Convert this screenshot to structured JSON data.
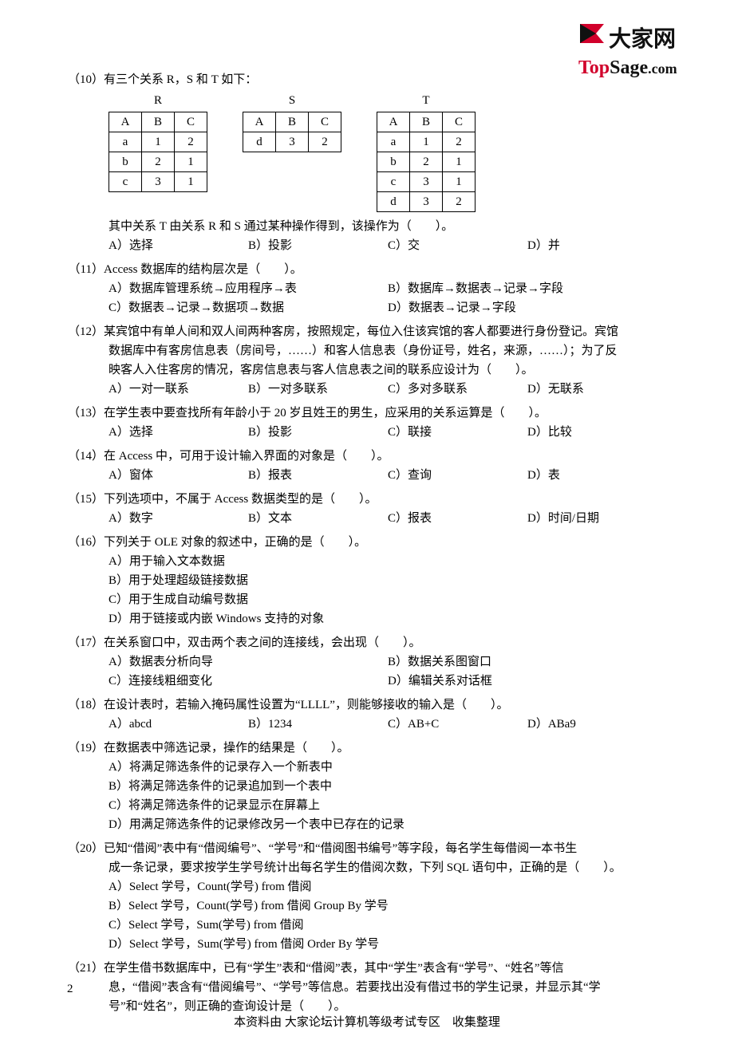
{
  "logo": {
    "cn": "大家网",
    "en_top": "Top",
    "en_sage": "Sage",
    "en_dot": ".com"
  },
  "q10": {
    "prefix": "（10）",
    "text": "有三个关系 R，S 和 T 如下：",
    "tables": {
      "R": {
        "name": "R",
        "head": [
          "A",
          "B",
          "C"
        ],
        "rows": [
          [
            "a",
            "1",
            "2"
          ],
          [
            "b",
            "2",
            "1"
          ],
          [
            "c",
            "3",
            "1"
          ]
        ]
      },
      "S": {
        "name": "S",
        "head": [
          "A",
          "B",
          "C"
        ],
        "rows": [
          [
            "d",
            "3",
            "2"
          ]
        ]
      },
      "T": {
        "name": "T",
        "head": [
          "A",
          "B",
          "C"
        ],
        "rows": [
          [
            "a",
            "1",
            "2"
          ],
          [
            "b",
            "2",
            "1"
          ],
          [
            "c",
            "3",
            "1"
          ],
          [
            "d",
            "3",
            "2"
          ]
        ]
      }
    },
    "after": "其中关系 T 由关系 R 和 S 通过某种操作得到，该操作为（　　）。",
    "opts": [
      "A）选择",
      "B）投影",
      "C）交",
      "D）并"
    ]
  },
  "q11": {
    "prefix": "（11）",
    "text": "Access 数据库的结构层次是（　　）。",
    "opts": [
      "A）数据库管理系统→应用程序→表",
      "B）数据库→数据表→记录→字段",
      "C）数据表→记录→数据项→数据",
      "D）数据表→记录→字段"
    ]
  },
  "q12": {
    "prefix": "（12）",
    "lines": [
      "某宾馆中有单人间和双人间两种客房，按照规定，每位入住该宾馆的客人都要进行身份登记。宾馆",
      "数据库中有客房信息表（房间号，……）和客人信息表（身份证号，姓名，来源，……）；为了反",
      "映客人入住客房的情况，客房信息表与客人信息表之间的联系应设计为（　　）。"
    ],
    "opts": [
      "A）一对一联系",
      "B）一对多联系",
      "C）多对多联系",
      "D）无联系"
    ]
  },
  "q13": {
    "prefix": "（13）",
    "text": "在学生表中要查找所有年龄小于 20 岁且姓王的男生，应采用的关系运算是（　　）。",
    "opts": [
      "A）选择",
      "B）投影",
      "C）联接",
      "D）比较"
    ]
  },
  "q14": {
    "prefix": "（14）",
    "text": "在 Access 中，可用于设计输入界面的对象是（　　）。",
    "opts": [
      "A）窗体",
      "B）报表",
      "C）查询",
      "D）表"
    ]
  },
  "q15": {
    "prefix": "（15）",
    "text": "下列选项中，不属于 Access 数据类型的是（　　）。",
    "opts": [
      "A）数字",
      "B）文本",
      "C）报表",
      "D）时间/日期"
    ]
  },
  "q16": {
    "prefix": "（16）",
    "text": "下列关于 OLE 对象的叙述中，正确的是（　　）。",
    "opts": [
      "A）用于输入文本数据",
      "B）用于处理超级链接数据",
      "C）用于生成自动编号数据",
      "D）用于链接或内嵌 Windows 支持的对象"
    ]
  },
  "q17": {
    "prefix": "（17）",
    "text": "在关系窗口中，双击两个表之间的连接线，会出现（　　）。",
    "opts": [
      "A）数据表分析向导",
      "B）数据关系图窗口",
      "C）连接线粗细变化",
      "D）编辑关系对话框"
    ]
  },
  "q18": {
    "prefix": "（18）",
    "text": "在设计表时，若输入掩码属性设置为“LLLL”，则能够接收的输入是（　　）。",
    "opts": [
      "A）abcd",
      "B）1234",
      "C）AB+C",
      "D）ABa9"
    ]
  },
  "q19": {
    "prefix": "（19）",
    "text": "在数据表中筛选记录，操作的结果是（　　）。",
    "opts": [
      "A）将满足筛选条件的记录存入一个新表中",
      "B）将满足筛选条件的记录追加到一个表中",
      "C）将满足筛选条件的记录显示在屏幕上",
      "D）用满足筛选条件的记录修改另一个表中已存在的记录"
    ]
  },
  "q20": {
    "prefix": "（20）",
    "lines": [
      "已知“借阅”表中有“借阅编号”、“学号”和“借阅图书编号”等字段，每名学生每借阅一本书生",
      "成一条记录，要求按学生学号统计出每名学生的借阅次数，下列 SQL 语句中，正确的是（　　）。"
    ],
    "opts": [
      "A）Select 学号，Count(学号) from 借阅",
      "B）Select 学号，Count(学号) from 借阅 Group By 学号",
      "C）Select 学号，Sum(学号) from 借阅",
      "D）Select 学号，Sum(学号) from 借阅 Order By 学号"
    ]
  },
  "q21": {
    "prefix": "（21）",
    "lines": [
      "在学生借书数据库中，已有“学生”表和“借阅”表，其中“学生”表含有“学号”、“姓名”等信",
      "息，“借阅”表含有“借阅编号”、“学号”等信息。若要找出没有借过书的学生记录，并显示其“学",
      "号”和“姓名”，则正确的查询设计是（　　）。"
    ]
  },
  "page_number": "2",
  "footer": "本资料由 大家论坛计算机等级考试专区　收集整理"
}
